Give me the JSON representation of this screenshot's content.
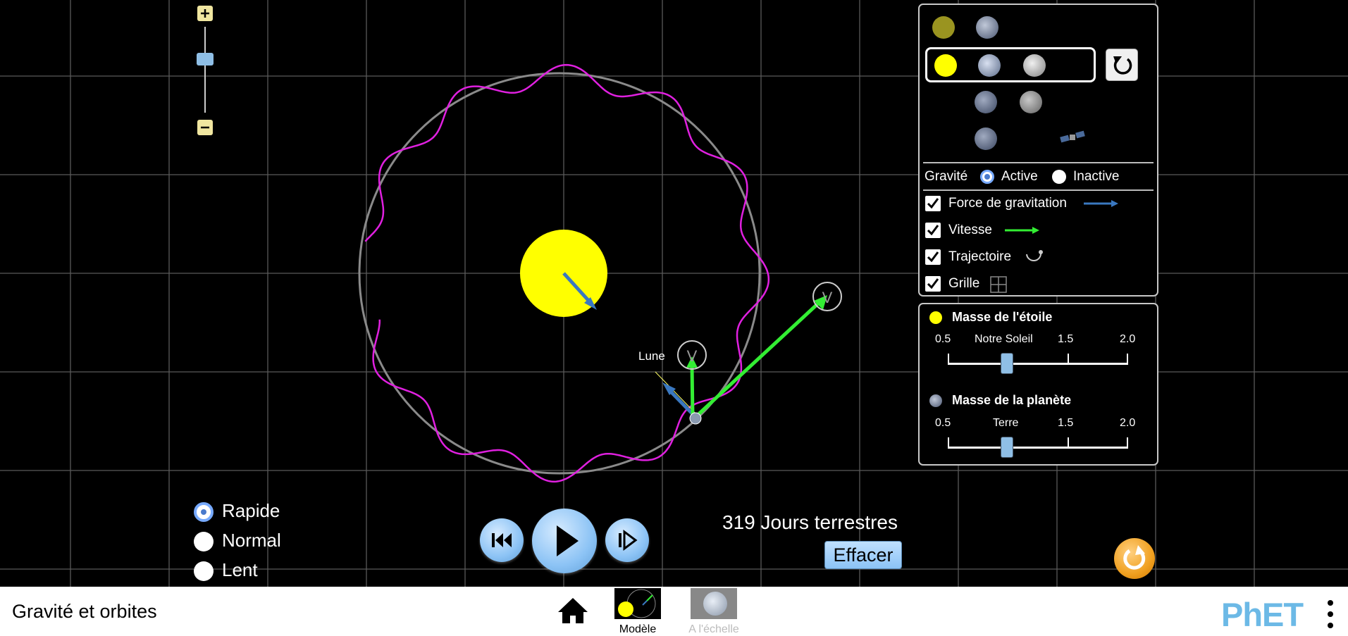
{
  "app": {
    "title": "Gravité et orbites"
  },
  "zoom": {
    "plus_icon": "plus-icon",
    "minus_icon": "minus-icon"
  },
  "scene": {
    "moon_label": "Lune",
    "velocity_marker_label": "V"
  },
  "body_panel": {
    "presets": [
      "star-planet",
      "star-planet-moon",
      "planet-moon",
      "planet-satellite"
    ],
    "selected_preset": "star-planet-moon",
    "reset_icon": "reset-icon"
  },
  "options": {
    "gravity": {
      "label": "Gravité",
      "active": "Active",
      "inactive": "Inactive",
      "selected": "Active"
    },
    "gravity_force": {
      "label": "Force de gravitation",
      "checked": true
    },
    "velocity": {
      "label": "Vitesse",
      "checked": true
    },
    "path": {
      "label": "Trajectoire",
      "checked": true
    },
    "grid": {
      "label": "Grille",
      "checked": true
    }
  },
  "mass": {
    "star": {
      "title": "Masse de l'étoile",
      "tick_low": "0.5",
      "tick_mid": "Notre Soleil",
      "tick_15": "1.5",
      "tick_high": "2.0",
      "value": 1.0
    },
    "planet": {
      "title": "Masse de la planète",
      "tick_low": "0.5",
      "tick_mid": "Terre",
      "tick_15": "1.5",
      "tick_high": "2.0",
      "value": 1.0
    }
  },
  "speed": {
    "fast": "Rapide",
    "normal": "Normal",
    "slow": "Lent",
    "selected": "Rapide"
  },
  "time": {
    "readout": "319 Jours terrestres",
    "clear_button": "Effacer"
  },
  "nav": {
    "model_label": "Modèle",
    "scale_label": "A l'échelle",
    "brand": "PhET"
  },
  "colors": {
    "trail": "#e020e0",
    "velocity": "#33ee33",
    "force": "#3a78c0",
    "star": "#ffff00",
    "orbit": "#888888"
  }
}
